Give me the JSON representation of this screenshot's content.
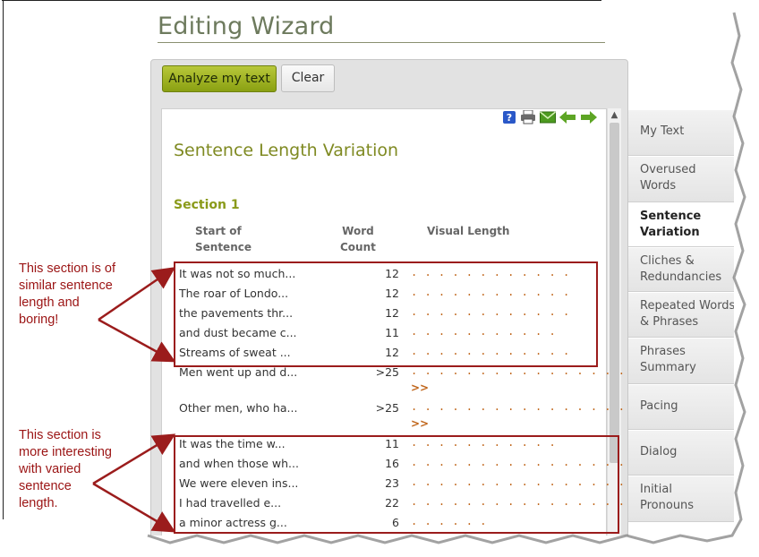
{
  "app": {
    "title": "Editing Wizard",
    "analyze_label": "Analyze my text",
    "clear_label": "Clear"
  },
  "report": {
    "heading": "Sentence Length Variation",
    "section": "Section 1",
    "col_start": "Start of\nSentence",
    "col_count": "Word\nCount",
    "col_visual": "Visual Length",
    "rows": [
      {
        "text": "It was not so much...",
        "count": "12",
        "dots": 12
      },
      {
        "text": "The roar of Londo...",
        "count": "12",
        "dots": 12
      },
      {
        "text": "the pavements thr...",
        "count": "12",
        "dots": 12
      },
      {
        "text": "and dust became c...",
        "count": "11",
        "dots": 11
      },
      {
        "text": "Streams of sweat ...",
        "count": "12",
        "dots": 12
      },
      {
        "text": "Men went up and d...",
        "count": ">25",
        "dots": 25,
        "more": ">>"
      },
      {
        "text": "Other men, who ha...",
        "count": ">25",
        "dots": 25,
        "more": ">>"
      },
      {
        "text": "It was the time w...",
        "count": "11",
        "dots": 11
      },
      {
        "text": "and when those wh...",
        "count": "16",
        "dots": 16
      },
      {
        "text": "We were eleven ins...",
        "count": "23",
        "dots": 23
      },
      {
        "text": "I had travelled e...",
        "count": "22",
        "dots": 22
      },
      {
        "text": "a minor actress g...",
        "count": "6",
        "dots": 6
      }
    ]
  },
  "toolbar_icons": [
    "help-icon",
    "print-icon",
    "email-icon",
    "back-arrow-icon",
    "forward-arrow-icon"
  ],
  "sidebar": {
    "items": [
      {
        "label": "My Text",
        "active": false
      },
      {
        "label": "Overused\nWords",
        "active": false
      },
      {
        "label": "Sentence\nVariation",
        "active": true
      },
      {
        "label": "Cliches &\nRedundancies",
        "active": false
      },
      {
        "label": "Repeated Words\n& Phrases",
        "active": false
      },
      {
        "label": "Phrases\nSummary",
        "active": false
      },
      {
        "label": "Pacing",
        "active": false
      },
      {
        "label": "Dialog",
        "active": false
      },
      {
        "label": "Initial\nPronouns",
        "active": false
      }
    ]
  },
  "annotations": {
    "boring": "This section is of\nsimilar sentence\nlength and\nboring!",
    "interesting": "This section is\nmore interesting\nwith varied\nsentence\nlength."
  },
  "colors": {
    "accent_green": "#8aa012",
    "heading_olive": "#7f8a22",
    "dots_orange": "#c0651a",
    "annotation_red": "#9b1c1c"
  }
}
